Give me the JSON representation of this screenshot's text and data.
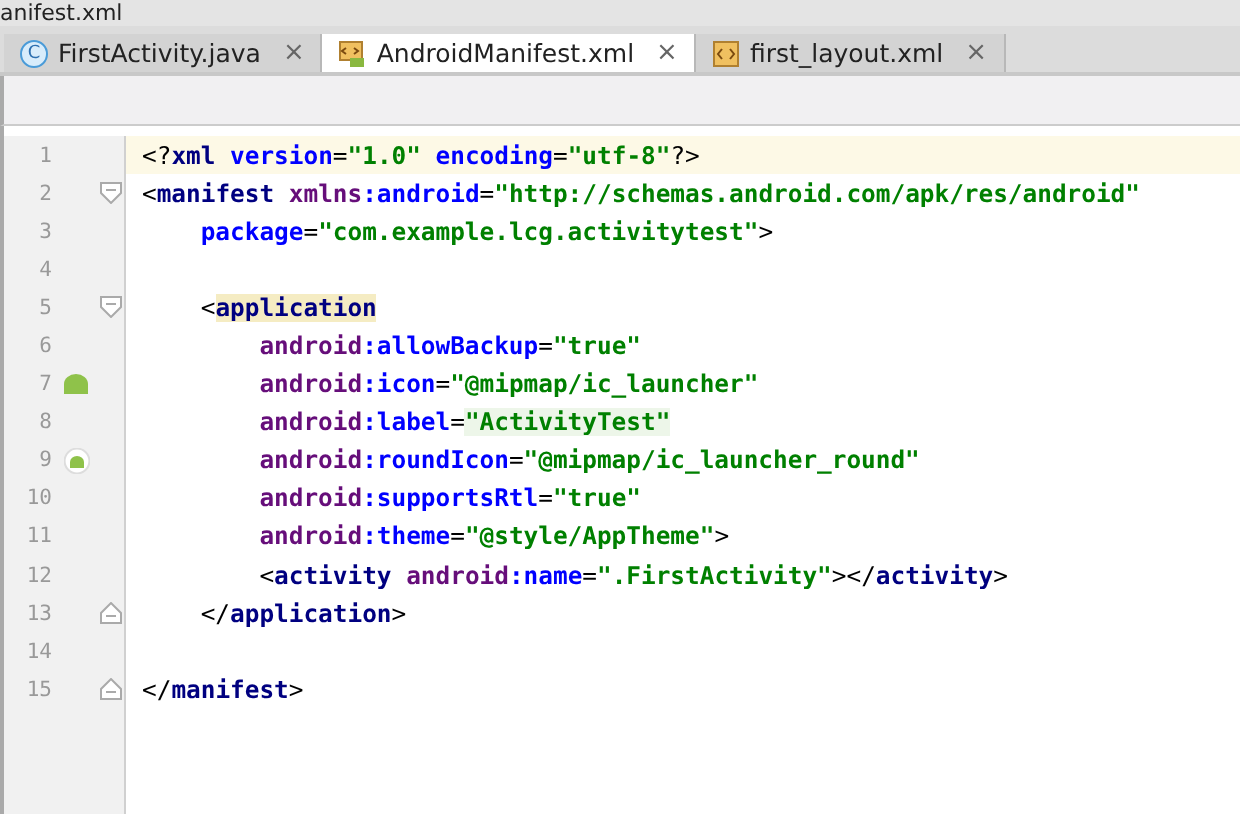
{
  "breadcrumb": "anifest.xml",
  "tabs": [
    {
      "label": "FirstActivity.java",
      "kind": "class",
      "badge": "C",
      "close": "×",
      "selected": false
    },
    {
      "label": "AndroidManifest.xml",
      "kind": "manifest",
      "close": "×",
      "selected": true
    },
    {
      "label": "first_layout.xml",
      "kind": "layout",
      "close": "×",
      "selected": false
    }
  ],
  "lines": [
    {
      "number": "1",
      "current": true,
      "kind": "plain",
      "tokens": [
        {
          "kind": "punct",
          "text": "<?"
        },
        {
          "kind": "tag",
          "text": "xml "
        },
        {
          "kind": "attr",
          "text": "version"
        },
        {
          "kind": "punct",
          "text": "="
        },
        {
          "kind": "value",
          "text": "\"1.0\" "
        },
        {
          "kind": "attr",
          "text": "encoding"
        },
        {
          "kind": "punct",
          "text": "="
        },
        {
          "kind": "value",
          "text": "\"utf-8\""
        },
        {
          "kind": "punct",
          "text": "?>"
        }
      ]
    },
    {
      "number": "2",
      "current": false,
      "kind": "fold-open",
      "tokens": [
        {
          "kind": "punct",
          "text": "<"
        },
        {
          "kind": "tag",
          "text": "manifest "
        },
        {
          "kind": "ns",
          "text": "xmlns"
        },
        {
          "kind": "attr",
          "text": ":android"
        },
        {
          "kind": "punct",
          "text": "="
        },
        {
          "kind": "value",
          "text": "\"http://schemas.android.com/apk/res/android\""
        }
      ]
    },
    {
      "number": "3",
      "current": false,
      "kind": "plain",
      "tokens": [
        {
          "kind": "attr",
          "text": "    package"
        },
        {
          "kind": "punct",
          "text": "="
        },
        {
          "kind": "value",
          "text": "\"com.example.lcg.activitytest\""
        },
        {
          "kind": "punct",
          "text": ">"
        }
      ]
    },
    {
      "number": "4",
      "current": false,
      "kind": "plain"
    },
    {
      "number": "5",
      "current": false,
      "kind": "fold-open",
      "tokens": [
        {
          "kind": "punct",
          "text": "    <"
        },
        {
          "kind": "tag-hl",
          "text": "application"
        }
      ]
    },
    {
      "number": "6",
      "current": false,
      "kind": "plain",
      "tokens": [
        {
          "kind": "ns",
          "text": "        android"
        },
        {
          "kind": "attr",
          "text": ":allowBackup"
        },
        {
          "kind": "punct",
          "text": "="
        },
        {
          "kind": "value",
          "text": "\"true\""
        }
      ]
    },
    {
      "number": "7",
      "current": false,
      "kind": "android",
      "tokens": [
        {
          "kind": "ns",
          "text": "        android"
        },
        {
          "kind": "attr",
          "text": ":icon"
        },
        {
          "kind": "punct",
          "text": "="
        },
        {
          "kind": "value",
          "text": "\"@mipmap/ic_launcher\""
        }
      ]
    },
    {
      "number": "8",
      "current": false,
      "kind": "plain",
      "tokens": [
        {
          "kind": "ns",
          "text": "        android"
        },
        {
          "kind": "attr",
          "text": ":label"
        },
        {
          "kind": "punct",
          "text": "="
        },
        {
          "kind": "value-hl",
          "text": "\"ActivityTest\""
        }
      ]
    },
    {
      "number": "9",
      "current": false,
      "kind": "android-round",
      "tokens": [
        {
          "kind": "ns",
          "text": "        android"
        },
        {
          "kind": "attr",
          "text": ":roundIcon"
        },
        {
          "kind": "punct",
          "text": "="
        },
        {
          "kind": "value",
          "text": "\"@mipmap/ic_launcher_round\""
        }
      ]
    },
    {
      "number": "10",
      "current": false,
      "kind": "plain",
      "tokens": [
        {
          "kind": "ns",
          "text": "        android"
        },
        {
          "kind": "attr",
          "text": ":supportsRtl"
        },
        {
          "kind": "punct",
          "text": "="
        },
        {
          "kind": "value",
          "text": "\"true\""
        }
      ]
    },
    {
      "number": "11",
      "current": false,
      "kind": "plain",
      "tokens": [
        {
          "kind": "ns",
          "text": "        android"
        },
        {
          "kind": "attr",
          "text": ":theme"
        },
        {
          "kind": "punct",
          "text": "="
        },
        {
          "kind": "value",
          "text": "\"@style/AppTheme\""
        },
        {
          "kind": "punct",
          "text": ">"
        }
      ]
    },
    {
      "number": "12",
      "current": false,
      "kind": "plain",
      "tokens": [
        {
          "kind": "punct",
          "text": "        <"
        },
        {
          "kind": "tag",
          "text": "activity "
        },
        {
          "kind": "ns",
          "text": "android"
        },
        {
          "kind": "attr",
          "text": ":name"
        },
        {
          "kind": "punct",
          "text": "="
        },
        {
          "kind": "value",
          "text": "\".FirstActivity\""
        },
        {
          "kind": "punct",
          "text": "></"
        },
        {
          "kind": "tag",
          "text": "activity"
        },
        {
          "kind": "punct",
          "text": ">"
        }
      ]
    },
    {
      "number": "13",
      "current": false,
      "kind": "fold-close",
      "tokens": [
        {
          "kind": "punct",
          "text": "    </"
        },
        {
          "kind": "tag",
          "text": "application"
        },
        {
          "kind": "punct",
          "text": ">"
        }
      ]
    },
    {
      "number": "14",
      "current": false,
      "kind": "plain"
    },
    {
      "number": "15",
      "current": false,
      "kind": "fold-close",
      "tokens": [
        {
          "kind": "punct",
          "text": "</"
        },
        {
          "kind": "tag",
          "text": "manifest"
        },
        {
          "kind": "punct",
          "text": ">"
        }
      ]
    }
  ]
}
